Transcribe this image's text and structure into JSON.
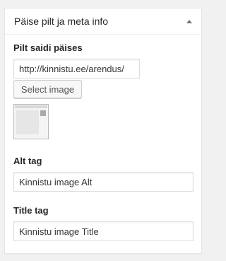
{
  "metabox": {
    "title": "Päise pilt ja meta info",
    "toggle_icon": "arrow-up-icon"
  },
  "header_image": {
    "label": "Pilt saidi päises",
    "url_value": "http://kinnistu.ee/arendus/",
    "select_button": "Select image",
    "thumbnail_icon": "image-thumbnail"
  },
  "alt_tag": {
    "label": "Alt tag",
    "value": "Kinnistu image Alt"
  },
  "title_tag": {
    "label": "Title tag",
    "value": "Kinnistu image Title"
  }
}
